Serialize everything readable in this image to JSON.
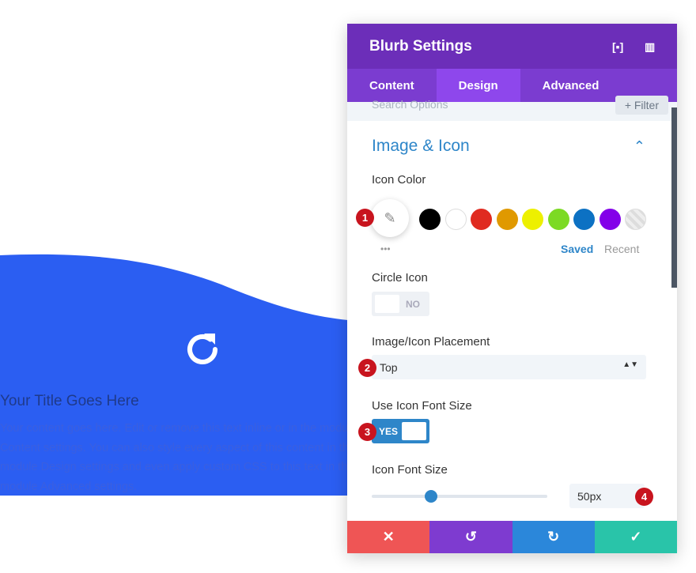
{
  "blurb": {
    "title": "Your Title Goes Here",
    "body_lines": [
      "Your content goes here. Edit or remove this text inline or in the module",
      "Content settings. You can also style every aspect of this content in the",
      "module Design settings and even apply custom CSS to this text in the",
      "module Advanced settings."
    ],
    "icon": "refresh-icon",
    "bg_color": "#2b5ef2"
  },
  "panel": {
    "title": "Blurb Settings",
    "tabs": [
      "Content",
      "Design",
      "Advanced"
    ],
    "active_tab": "Design",
    "search_placeholder": "Search Options",
    "filter_label": "+ Filter",
    "section": "Image & Icon",
    "icon_color": {
      "label": "Icon Color",
      "swatches": [
        "#000000",
        "#ffffff",
        "#e02b20",
        "#e09900",
        "#edf000",
        "#7cda24",
        "#0c71c3",
        "#8300e9"
      ],
      "saved": "Saved",
      "recent": "Recent",
      "more": "•••"
    },
    "circle_icon": {
      "label": "Circle Icon",
      "value": "NO"
    },
    "placement": {
      "label": "Image/Icon Placement",
      "value": "Top"
    },
    "use_font_size": {
      "label": "Use Icon Font Size",
      "value": "YES"
    },
    "font_size": {
      "label": "Icon Font Size",
      "value": "50px",
      "slider_fraction": 0.3
    },
    "badges": [
      "1",
      "2",
      "3",
      "4"
    ]
  }
}
